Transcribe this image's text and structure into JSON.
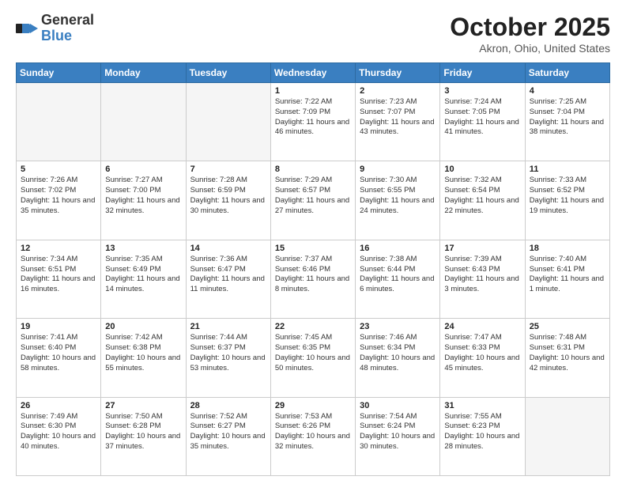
{
  "logo": {
    "general": "General",
    "blue": "Blue"
  },
  "title": {
    "month": "October 2025",
    "location": "Akron, Ohio, United States"
  },
  "weekdays": [
    "Sunday",
    "Monday",
    "Tuesday",
    "Wednesday",
    "Thursday",
    "Friday",
    "Saturday"
  ],
  "weeks": [
    [
      {
        "day": "",
        "info": ""
      },
      {
        "day": "",
        "info": ""
      },
      {
        "day": "",
        "info": ""
      },
      {
        "day": "1",
        "info": "Sunrise: 7:22 AM\nSunset: 7:09 PM\nDaylight: 11 hours and 46 minutes."
      },
      {
        "day": "2",
        "info": "Sunrise: 7:23 AM\nSunset: 7:07 PM\nDaylight: 11 hours and 43 minutes."
      },
      {
        "day": "3",
        "info": "Sunrise: 7:24 AM\nSunset: 7:05 PM\nDaylight: 11 hours and 41 minutes."
      },
      {
        "day": "4",
        "info": "Sunrise: 7:25 AM\nSunset: 7:04 PM\nDaylight: 11 hours and 38 minutes."
      }
    ],
    [
      {
        "day": "5",
        "info": "Sunrise: 7:26 AM\nSunset: 7:02 PM\nDaylight: 11 hours and 35 minutes."
      },
      {
        "day": "6",
        "info": "Sunrise: 7:27 AM\nSunset: 7:00 PM\nDaylight: 11 hours and 32 minutes."
      },
      {
        "day": "7",
        "info": "Sunrise: 7:28 AM\nSunset: 6:59 PM\nDaylight: 11 hours and 30 minutes."
      },
      {
        "day": "8",
        "info": "Sunrise: 7:29 AM\nSunset: 6:57 PM\nDaylight: 11 hours and 27 minutes."
      },
      {
        "day": "9",
        "info": "Sunrise: 7:30 AM\nSunset: 6:55 PM\nDaylight: 11 hours and 24 minutes."
      },
      {
        "day": "10",
        "info": "Sunrise: 7:32 AM\nSunset: 6:54 PM\nDaylight: 11 hours and 22 minutes."
      },
      {
        "day": "11",
        "info": "Sunrise: 7:33 AM\nSunset: 6:52 PM\nDaylight: 11 hours and 19 minutes."
      }
    ],
    [
      {
        "day": "12",
        "info": "Sunrise: 7:34 AM\nSunset: 6:51 PM\nDaylight: 11 hours and 16 minutes."
      },
      {
        "day": "13",
        "info": "Sunrise: 7:35 AM\nSunset: 6:49 PM\nDaylight: 11 hours and 14 minutes."
      },
      {
        "day": "14",
        "info": "Sunrise: 7:36 AM\nSunset: 6:47 PM\nDaylight: 11 hours and 11 minutes."
      },
      {
        "day": "15",
        "info": "Sunrise: 7:37 AM\nSunset: 6:46 PM\nDaylight: 11 hours and 8 minutes."
      },
      {
        "day": "16",
        "info": "Sunrise: 7:38 AM\nSunset: 6:44 PM\nDaylight: 11 hours and 6 minutes."
      },
      {
        "day": "17",
        "info": "Sunrise: 7:39 AM\nSunset: 6:43 PM\nDaylight: 11 hours and 3 minutes."
      },
      {
        "day": "18",
        "info": "Sunrise: 7:40 AM\nSunset: 6:41 PM\nDaylight: 11 hours and 1 minute."
      }
    ],
    [
      {
        "day": "19",
        "info": "Sunrise: 7:41 AM\nSunset: 6:40 PM\nDaylight: 10 hours and 58 minutes."
      },
      {
        "day": "20",
        "info": "Sunrise: 7:42 AM\nSunset: 6:38 PM\nDaylight: 10 hours and 55 minutes."
      },
      {
        "day": "21",
        "info": "Sunrise: 7:44 AM\nSunset: 6:37 PM\nDaylight: 10 hours and 53 minutes."
      },
      {
        "day": "22",
        "info": "Sunrise: 7:45 AM\nSunset: 6:35 PM\nDaylight: 10 hours and 50 minutes."
      },
      {
        "day": "23",
        "info": "Sunrise: 7:46 AM\nSunset: 6:34 PM\nDaylight: 10 hours and 48 minutes."
      },
      {
        "day": "24",
        "info": "Sunrise: 7:47 AM\nSunset: 6:33 PM\nDaylight: 10 hours and 45 minutes."
      },
      {
        "day": "25",
        "info": "Sunrise: 7:48 AM\nSunset: 6:31 PM\nDaylight: 10 hours and 42 minutes."
      }
    ],
    [
      {
        "day": "26",
        "info": "Sunrise: 7:49 AM\nSunset: 6:30 PM\nDaylight: 10 hours and 40 minutes."
      },
      {
        "day": "27",
        "info": "Sunrise: 7:50 AM\nSunset: 6:28 PM\nDaylight: 10 hours and 37 minutes."
      },
      {
        "day": "28",
        "info": "Sunrise: 7:52 AM\nSunset: 6:27 PM\nDaylight: 10 hours and 35 minutes."
      },
      {
        "day": "29",
        "info": "Sunrise: 7:53 AM\nSunset: 6:26 PM\nDaylight: 10 hours and 32 minutes."
      },
      {
        "day": "30",
        "info": "Sunrise: 7:54 AM\nSunset: 6:24 PM\nDaylight: 10 hours and 30 minutes."
      },
      {
        "day": "31",
        "info": "Sunrise: 7:55 AM\nSunset: 6:23 PM\nDaylight: 10 hours and 28 minutes."
      },
      {
        "day": "",
        "info": ""
      }
    ]
  ]
}
